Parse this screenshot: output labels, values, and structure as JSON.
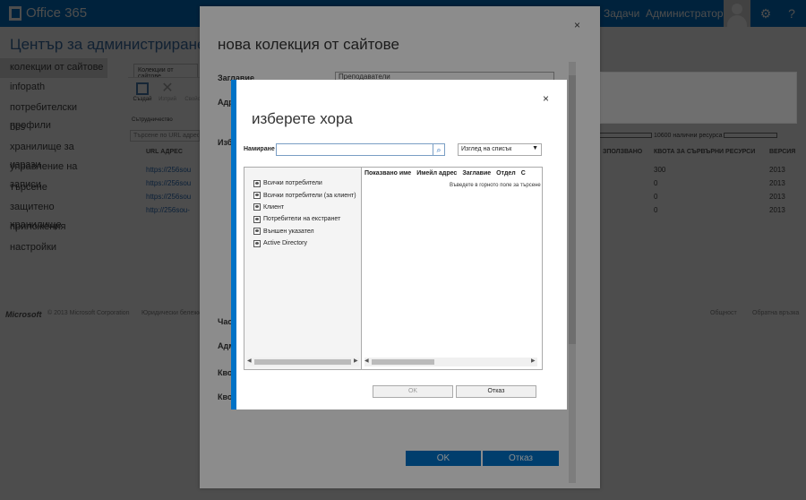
{
  "topbar": {
    "brand": "Office 365",
    "tasks": "Задачи",
    "admin": "Администратор",
    "gear_icon": "gear-icon",
    "help_icon": "?"
  },
  "background": {
    "page_title": "Център за администриране на SharePoint",
    "nav": [
      {
        "label": "колекции от сайтове"
      },
      {
        "label": "infopath"
      },
      {
        "label": "потребителски профили"
      },
      {
        "label": "bcs"
      },
      {
        "label": "хранилище за изрази"
      },
      {
        "label": "управление на записи"
      },
      {
        "label": "търсене"
      },
      {
        "label": "защитено хранилище"
      },
      {
        "label": "приложения"
      },
      {
        "label": "настройки"
      }
    ],
    "ribbon_tab": "Колекции от сайтове",
    "ribbon_create": "Създай",
    "ribbon_delete": "Изтрий",
    "ribbon_props": "Свойс",
    "ribbon_group": "Сътрудничество",
    "search_placeholder": "Търсене по URL адрес",
    "col_url": "URL АДРЕС",
    "col_used": "ЗПОЛЗВАНО",
    "col_quota": "КВОТА ЗА СЪРВЪРНИ РЕСУРСИ",
    "col_version": "ВЕРСИЯ",
    "resources": "10600 налични ресурса",
    "rows": [
      {
        "url": "https://256sou",
        "used": "300",
        "version": "2013"
      },
      {
        "url": "https://256sou",
        "used": "0",
        "version": "2013"
      },
      {
        "url": "https://256sou",
        "used": "0",
        "version": "2013"
      },
      {
        "url": "http://256sou-",
        "used": "0",
        "version": "2013"
      }
    ],
    "footer_copyright": "© 2013 Microsoft Corporation",
    "footer_legal": "Юридически бележки",
    "footer_community": "Общност",
    "footer_feedback": "Обратна връзка",
    "ms_logo": "Microsoft"
  },
  "outer_dialog": {
    "title": "нова колекция от сайтове",
    "field_title": "Заглавие",
    "field_address": "Адр",
    "field_template": "Изб",
    "field_time": "Час",
    "field_admin": "Адм",
    "field_quota": "Кво",
    "field_quota2": "Кво",
    "title_value": "Преподаватели",
    "ok": "OK",
    "cancel": "Отказ",
    "close": "×"
  },
  "people_dialog": {
    "title": "изберете хора",
    "close": "×",
    "find_label": "Намиране",
    "find_value": "",
    "view_select": "Изглед на списък",
    "tree": [
      {
        "label": "Всички потребители"
      },
      {
        "label": "Всички потребители (за клиент)"
      },
      {
        "label": "Клиент"
      },
      {
        "label": "Потребители на екстранет"
      },
      {
        "label": "Външен указател"
      },
      {
        "label": "Active Directory"
      }
    ],
    "columns": [
      "Показвано име",
      "Имейл адрес",
      "Заглавие",
      "Отдел",
      "С"
    ],
    "hint": "Въведете в горното поле за търсене",
    "ok": "OK",
    "cancel": "Отказ"
  },
  "colors": {
    "accent": "#0072c6"
  }
}
